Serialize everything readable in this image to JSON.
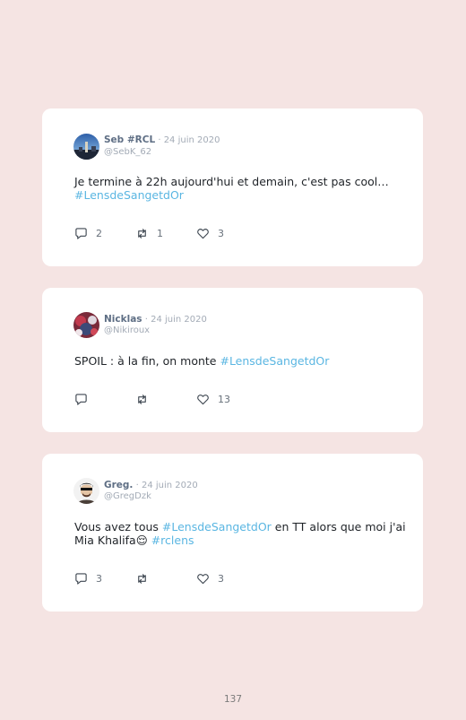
{
  "tweets": [
    {
      "name": "Seb #RCL",
      "separator": " · ",
      "date": "24 juin 2020",
      "handle": "@SebK_62",
      "text_lines": [
        "Je termine à 22h aujourd'hui et demain, c'est pas cool…"
      ],
      "hashtag": "#LensdeSangetdOr",
      "replies": "2",
      "retweets": "1",
      "likes": "3"
    },
    {
      "name": "Nicklas",
      "separator": " · ",
      "date": "24 juin 2020",
      "handle": "@Nikiroux",
      "text": "SPOIL : à la fin, on monte ",
      "hashtag": "#LensdeSangetdOr",
      "replies": "",
      "retweets": "",
      "likes": "13"
    },
    {
      "name": "Greg.",
      "separator": " · ",
      "date": "24 juin 2020",
      "handle": "@GregDzk",
      "text_a": "Vous avez tous ",
      "hashtag_a": "#LensdeSangetdOr",
      "text_b": " en TT alors que moi j'ai",
      "text_c": "Mia Khalifa",
      "emoji": "😌",
      "hashtag_b": "#rclens",
      "replies": "3",
      "retweets": "",
      "likes": "3"
    }
  ],
  "page_number": "137",
  "colors": {
    "background": "#f5e4e3",
    "card": "#ffffff",
    "hashtag": "#5ab6e2",
    "name": "#5e6e84",
    "meta": "#a3abb6"
  },
  "icons": [
    "reply-icon",
    "retweet-icon",
    "like-icon"
  ]
}
